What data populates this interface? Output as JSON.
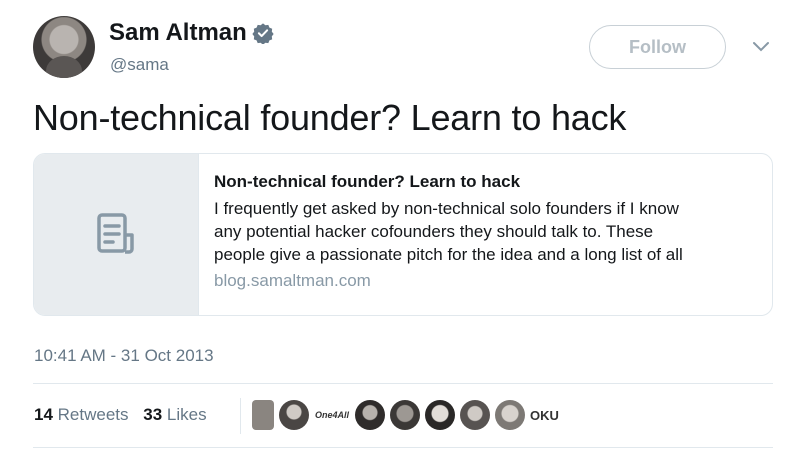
{
  "author": {
    "name": "Sam Altman",
    "handle": "@sama",
    "verified": true
  },
  "follow_button": {
    "label": "Follow"
  },
  "tweet": {
    "text": "Non-technical founder? Learn to hack"
  },
  "card": {
    "title": "Non-technical founder? Learn to hack",
    "description_lines": [
      "I frequently get asked by non-technical solo founders if I know",
      "any potential hacker cofounders they should talk to.  These",
      "people give a passionate pitch for the idea and a long list of all"
    ],
    "domain": "blog.samaltman.com",
    "thumbnail_icon": "document-icon"
  },
  "timestamp": "10:41 AM - 31 Oct 2013",
  "stats": {
    "retweets_count": "14",
    "retweets_label": "Retweets",
    "likes_count": "33",
    "likes_label": "Likes"
  },
  "facepile": {
    "logo_text": "One4All",
    "oku_text": "OKU"
  },
  "colors": {
    "text_primary": "#14171a",
    "text_secondary": "#657786",
    "verified_blue": "#657786",
    "border": "#e1e8ed"
  }
}
